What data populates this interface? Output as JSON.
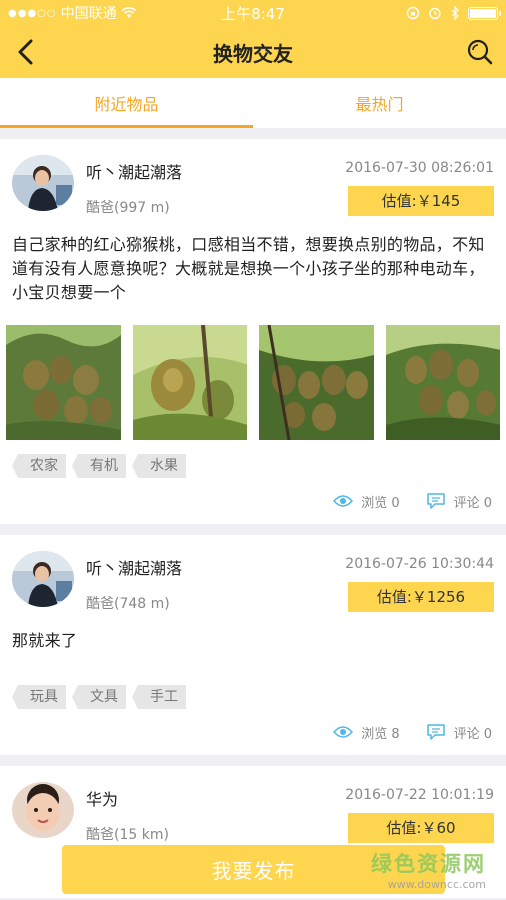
{
  "status_bar": {
    "carrier": "中国联通",
    "time": "上午8:47"
  },
  "header": {
    "title": "换物交友"
  },
  "tabs": [
    {
      "label": "附近物品",
      "active": true
    },
    {
      "label": "最热门",
      "active": false
    }
  ],
  "posts": [
    {
      "username": "听丶潮起潮落",
      "location": "酷爸(997 m)",
      "timestamp": "2016-07-30 08:26:01",
      "price": "估值:￥145",
      "description": "自己家种的红心猕猴桃，口感相当不错，想要换点别的物品，不知道有没有人愿意换呢？大概就是想换一个小孩子坐的那种电动车，小宝贝想要一个",
      "tags": [
        "农家",
        "有机",
        "水果"
      ],
      "views": "浏览 0",
      "comments": "评论 0"
    },
    {
      "username": "听丶潮起潮落",
      "location": "酷爸(748 m)",
      "timestamp": "2016-07-26 10:30:44",
      "price": "估值:￥1256",
      "description": "那就来了",
      "tags": [
        "玩具",
        "文具",
        "手工"
      ],
      "views": "浏览 8",
      "comments": "评论 0"
    },
    {
      "username": "华为",
      "location": "酷爸(15 km)",
      "timestamp": "2016-07-22 10:01:19",
      "price": "估值:￥60"
    }
  ],
  "publish_button": "我要发布",
  "watermark": {
    "title": "绿色资源网",
    "url": "www.downcc.com"
  },
  "colors": {
    "accent": "#fdd54f",
    "tab_text": "#f5a623",
    "icon_blue": "#4fb6e6"
  }
}
